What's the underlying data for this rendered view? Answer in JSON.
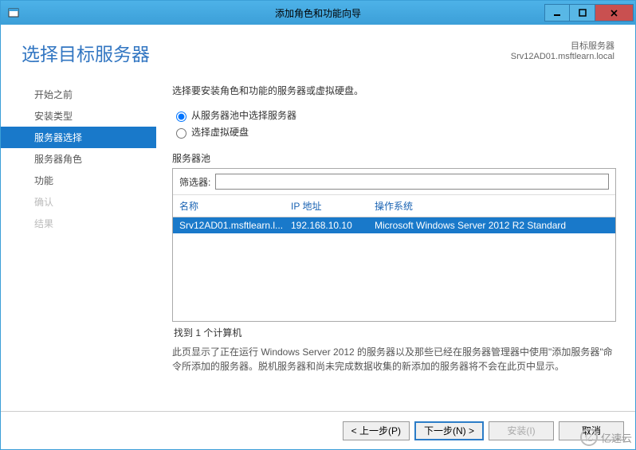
{
  "titlebar": {
    "title": "添加角色和功能向导"
  },
  "header": {
    "page_title": "选择目标服务器",
    "target_label": "目标服务器",
    "target_value": "Srv12AD01.msftlearn.local"
  },
  "sidebar": {
    "items": [
      {
        "label": "开始之前",
        "state": "normal"
      },
      {
        "label": "安装类型",
        "state": "normal"
      },
      {
        "label": "服务器选择",
        "state": "active"
      },
      {
        "label": "服务器角色",
        "state": "normal"
      },
      {
        "label": "功能",
        "state": "normal"
      },
      {
        "label": "确认",
        "state": "disabled"
      },
      {
        "label": "结果",
        "state": "disabled"
      }
    ]
  },
  "content": {
    "intro": "选择要安装角色和功能的服务器或虚拟硬盘。",
    "radio": {
      "opt1": "从服务器池中选择服务器",
      "opt2": "选择虚拟硬盘"
    },
    "pool_label": "服务器池",
    "filter_label": "筛选器:",
    "filter_value": "",
    "columns": {
      "name": "名称",
      "ip": "IP 地址",
      "os": "操作系统"
    },
    "rows": [
      {
        "name": "Srv12AD01.msftlearn.l...",
        "ip": "192.168.10.10",
        "os": "Microsoft Windows Server 2012 R2 Standard"
      }
    ],
    "count_text": "找到 1 个计算机",
    "desc": "此页显示了正在运行 Windows Server 2012 的服务器以及那些已经在服务器管理器中使用\"添加服务器\"命令所添加的服务器。脱机服务器和尚未完成数据收集的新添加的服务器将不会在此页中显示。"
  },
  "footer": {
    "prev": "< 上一步(P)",
    "next": "下一步(N) >",
    "install": "安装(I)",
    "cancel": "取消"
  },
  "watermark": "亿速云"
}
